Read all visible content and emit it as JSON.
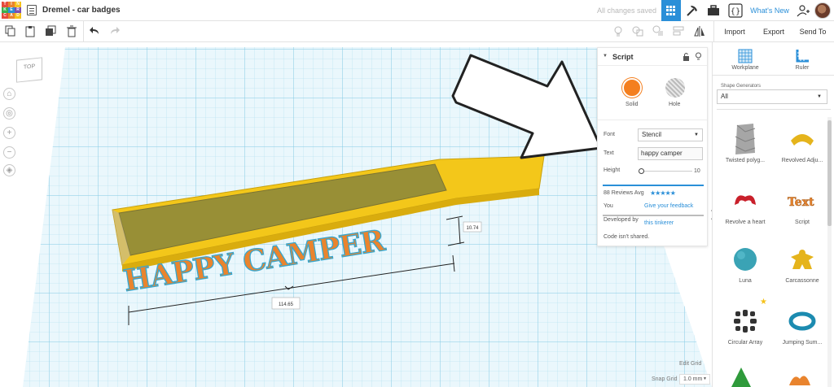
{
  "app": {
    "logo_letters": [
      "T",
      "I",
      "N",
      "K",
      "E",
      "R",
      "C",
      "A",
      "D"
    ],
    "logo_colors": [
      "#e74b3c",
      "#e9842e",
      "#f5c21b",
      "#3bb04c",
      "#2a8fd8",
      "#7a4fb2",
      "#e74b3c",
      "#e9842e",
      "#f5c21b"
    ],
    "document_title": "Dremel - car badges",
    "save_status": "All changes saved",
    "whats_new": "What's New",
    "accent_color": "#2a8fd8"
  },
  "toolbar": {
    "import_label": "Import",
    "export_label": "Export",
    "send_to_label": "Send To"
  },
  "viewcube": {
    "label": "TOP"
  },
  "canvas": {
    "text_shape": "HAPPY CAMPER",
    "dimension_height": "10.74",
    "dimension_width": "114.65",
    "badge_color": "#f3c71a",
    "text_color": "#e9842e",
    "grid_color": "#9fd5ea"
  },
  "inspector": {
    "title": "Script",
    "solid_label": "Solid",
    "hole_label": "Hole",
    "solid_color": "#f47f1f",
    "font_label": "Font",
    "font_value": "Stencil",
    "text_label": "Text",
    "text_value": "happy camper",
    "height_label": "Height",
    "height_max": "10",
    "reviews_label": "88 Reviews Avg",
    "rating_stars": 5,
    "you_label": "You",
    "feedback_link": "Give your feedback",
    "developed_by_label": "Developed by",
    "developer_link": "this tinkerer",
    "code_status": "Code isn't shared."
  },
  "right_panel": {
    "workplane_label": "Workplane",
    "ruler_label": "Ruler",
    "section_title": "Shape Generators",
    "category_value": "All",
    "shapes": [
      {
        "label": "Twisted polyg..."
      },
      {
        "label": "Revolved Adju..."
      },
      {
        "label": "Revolve a heart"
      },
      {
        "label": "Script"
      },
      {
        "label": "Luna"
      },
      {
        "label": "Carcassonne"
      },
      {
        "label": "Circular Array"
      },
      {
        "label": "Jumping Sum..."
      }
    ]
  },
  "footer": {
    "edit_grid_label": "Edit Grid",
    "snap_grid_label": "Snap Grid",
    "snap_grid_value": "1.0 mm"
  }
}
